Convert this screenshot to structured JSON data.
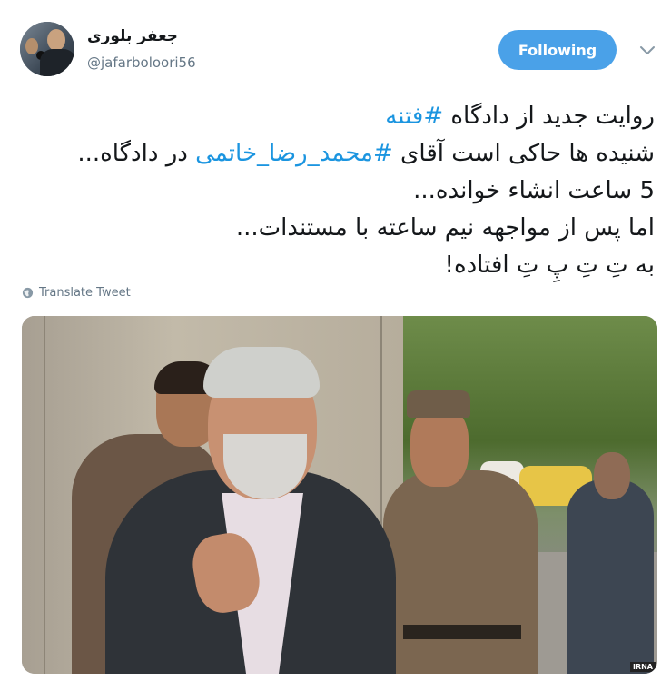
{
  "tweet": {
    "author_name": "جعفر بلوری",
    "author_handle": "@jafarboloori56",
    "follow_label": "Following",
    "lines": [
      {
        "prefix": "روایت جدید از دادگاه ",
        "hashtag": "#فتنه",
        "suffix": ""
      },
      {
        "prefix": "شنیده ها حاکی است آقای ",
        "hashtag": "#محمد_رضا_خاتمی",
        "suffix": " در دادگاه..."
      },
      {
        "prefix": "5 ساعت انشاء خوانده...",
        "hashtag": "",
        "suffix": ""
      },
      {
        "prefix": "اما پس از مواجهه نیم ساعته با مستندات...",
        "hashtag": "",
        "suffix": ""
      },
      {
        "prefix": "به تِ تِ پِ تِ افتاده!",
        "hashtag": "",
        "suffix": ""
      }
    ],
    "translate_label": "Translate Tweet",
    "media_credit": "IRNA"
  },
  "colors": {
    "accent": "#1b95e0",
    "follow_button": "#4aa1e8",
    "muted": "#657786",
    "text": "#14171a"
  },
  "icons": {
    "more": "chevron-down-icon",
    "translate": "globe-icon"
  }
}
